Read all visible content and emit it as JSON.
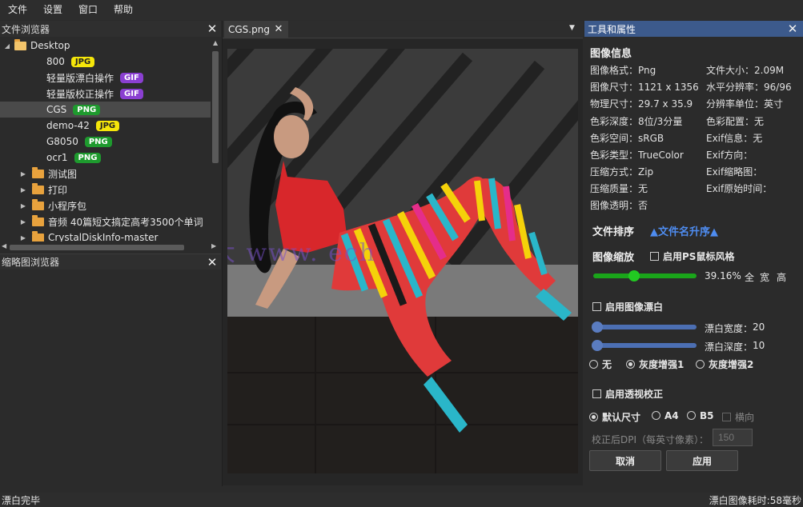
{
  "menu": [
    "文件",
    "设置",
    "窗口",
    "帮助"
  ],
  "file_browser": {
    "title": "文件浏览器",
    "root": "Desktop",
    "files": [
      {
        "name": "800",
        "badge": "JPG"
      },
      {
        "name": "轻量版漂白操作",
        "badge": "GIF"
      },
      {
        "name": "轻量版校正操作",
        "badge": "GIF"
      },
      {
        "name": "CGS",
        "badge": "PNG"
      },
      {
        "name": "demo-42",
        "badge": "JPG"
      },
      {
        "name": "G8050",
        "badge": "PNG"
      },
      {
        "name": "ocr1",
        "badge": "PNG"
      }
    ],
    "folders": [
      "测试图",
      "打印",
      "小程序包",
      "音频 40篇短文搞定高考3500个单词",
      "CrystalDiskInfo-master"
    ]
  },
  "badge_colors": {
    "JPG": {
      "bg": "#f5e60a",
      "fg": "#222222"
    },
    "GIF": {
      "bg": "#8a3fd1",
      "fg": "#ffffff"
    },
    "PNG": {
      "bg": "#1e9a2e",
      "fg": "#ffffff"
    }
  },
  "thumb_browser": {
    "title": "缩略图浏览器"
  },
  "tab": {
    "label": "CGS.png"
  },
  "watermark": "大         www.          ech",
  "props": {
    "title": "工具和属性",
    "info_title": "图像信息",
    "left": [
      "图像格式：Png",
      "图像尺寸：1121 x 1356",
      "物理尺寸：29.7 x 35.9",
      "色彩深度：8位/3分量",
      "色彩空间：sRGB",
      "色彩类型：TrueColor",
      "压缩方式：Zip",
      "压缩质量：无",
      "图像透明：否"
    ],
    "right": [
      "文件大小：2.09M",
      "水平分辨率：96/96",
      "分辨率单位：英寸",
      "色彩配置：无",
      "Exif信息：无",
      "Exif方向：",
      "Exif缩略图：",
      "Exif原始时间："
    ],
    "sort_label": "文件排序",
    "sort_value": "▲文件名升序▲",
    "zoom_label": "图像缩放",
    "ps_mouse": "启用PS鼠标风格",
    "zoom_pct": "39.16%",
    "zoom_fraction": 0.3916,
    "zoom_full": "全",
    "zoom_width": "宽",
    "zoom_height": "高",
    "bleach_label": "启用图像漂白",
    "bleach_width_label": "漂白宽度：",
    "bleach_width": "20",
    "bleach_depth_label": "漂白深度：",
    "bleach_depth": "10",
    "gray_opts": [
      "无",
      "灰度增强1",
      "灰度增强2"
    ],
    "perspective_label": "启用透视校正",
    "size_opts": [
      "默认尺寸",
      "A4",
      "B5"
    ],
    "landscape": "横向",
    "dpi_label": "校正后DPI（每英寸像素）：",
    "dpi_placeholder": "150",
    "cancel": "取消",
    "apply": "应用",
    "slider_color": "#1aa51a",
    "slider_blue": "#4c6fb3"
  },
  "status": {
    "left": "漂白完毕",
    "right": "漂白图像耗时:58毫秒"
  }
}
